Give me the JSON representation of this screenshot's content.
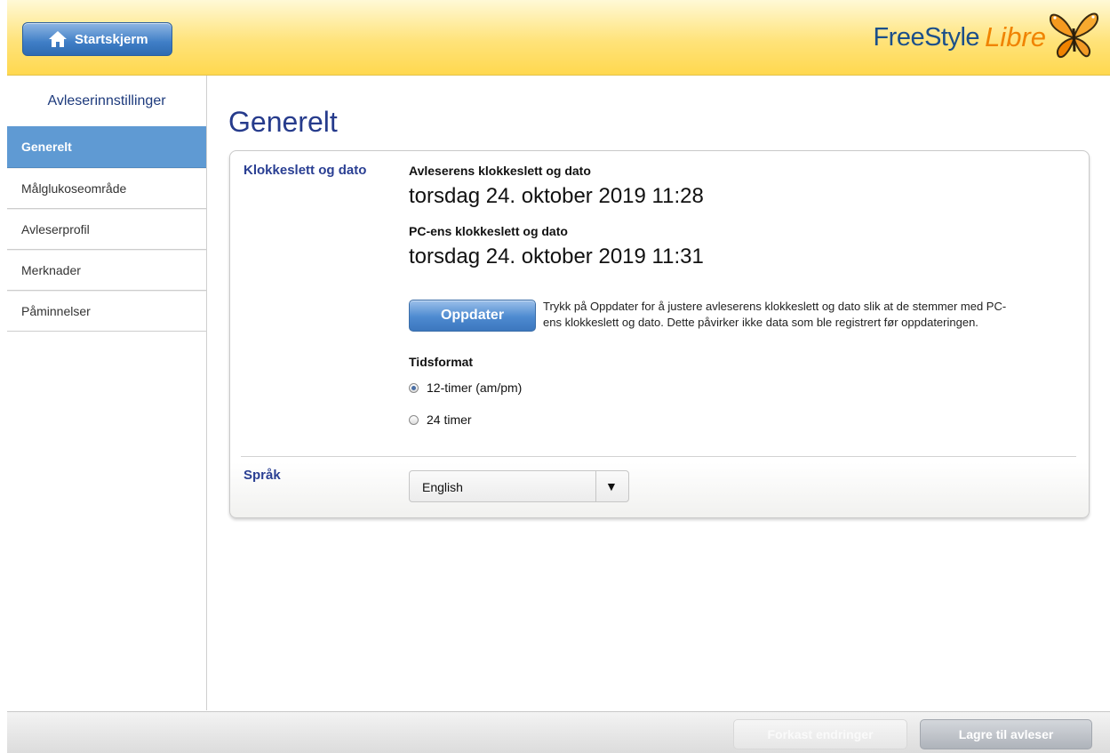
{
  "header": {
    "home_label": "Startskjerm",
    "logo_part1": "FreeStyle",
    "logo_part2": "Libre",
    "home_icon": "home-icon",
    "logo_icon": "butterfly-icon"
  },
  "sidebar": {
    "title": "Avleserinnstillinger",
    "items": [
      {
        "label": "Generelt",
        "active": true
      },
      {
        "label": "Målglukoseområde",
        "active": false
      },
      {
        "label": "Avleserprofil",
        "active": false
      },
      {
        "label": "Merknader",
        "active": false
      },
      {
        "label": "Påminnelser",
        "active": false
      }
    ]
  },
  "main": {
    "title": "Generelt",
    "clock_section": {
      "label": "Klokkeslett og dato",
      "reader_label": "Avleserens klokkeslett og dato",
      "reader_value": "torsdag 24. oktober 2019 11:28",
      "pc_label": "PC-ens klokkeslett og dato",
      "pc_value": "torsdag 24. oktober 2019 11:31",
      "update_button": "Oppdater",
      "hint": "Trykk på Oppdater for å justere avleserens klokkeslett og dato slik at de stemmer med PC-ens klokkeslett og dato. Dette påvirker ikke data som ble registrert før oppdateringen.",
      "time_format_label": "Tidsformat",
      "options": [
        {
          "label": "12-timer (am/pm)",
          "selected": true
        },
        {
          "label": "24 timer",
          "selected": false
        }
      ]
    },
    "language_section": {
      "label": "Språk",
      "selected": "English",
      "arrow": "▼"
    }
  },
  "footer": {
    "discard_label": "Forkast endringer",
    "save_label": "Lagre til avleser"
  },
  "colors": {
    "accent_blue": "#2a3f93",
    "active_tab": "#5f9ad3",
    "header_yellow": "#ffd84f",
    "logo_orange": "#f08300"
  }
}
